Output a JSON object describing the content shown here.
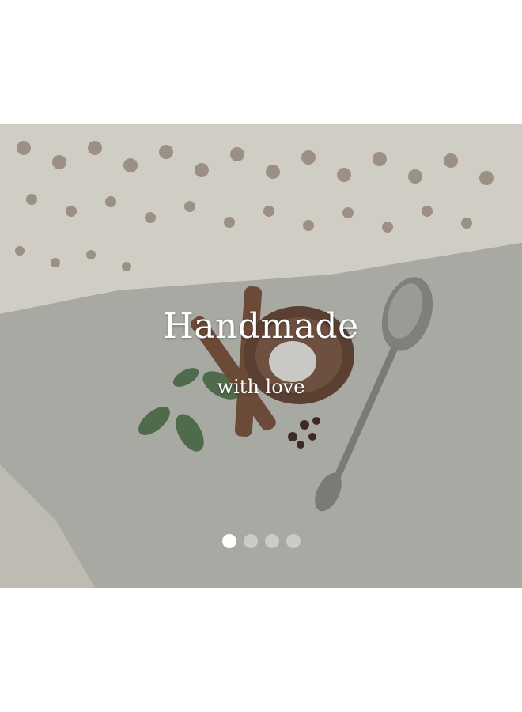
{
  "hero": {
    "title": "Handmade",
    "subtitle": "with love",
    "image_icon": "spices-on-linen-photo"
  },
  "carousel": {
    "slides": 4,
    "active_index": 0
  },
  "colors": {
    "overlay": "#8e8f8a",
    "dot_active": "#ffffff",
    "dot_inactive": "#c8c8c8"
  }
}
